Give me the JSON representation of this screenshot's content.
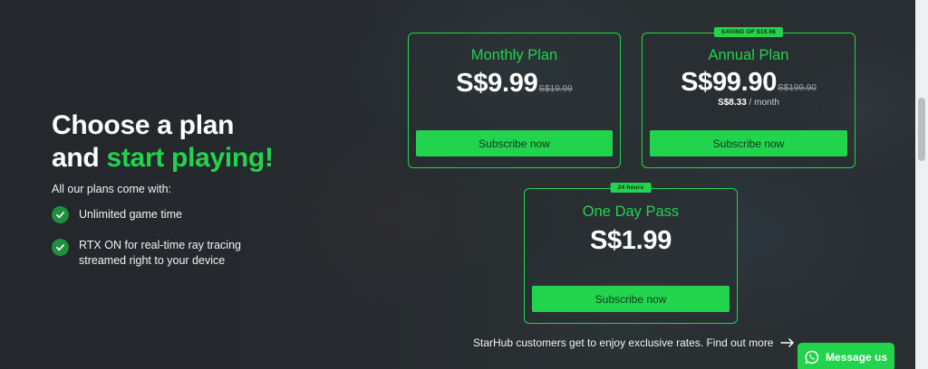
{
  "hero": {
    "heading_line1": "Choose a plan",
    "heading_line2_prefix": "and ",
    "heading_line2_accent": "start playing!",
    "features_intro": "All our plans come with:",
    "features": [
      "Unlimited game time",
      "RTX ON for real-time ray tracing streamed right to your device"
    ]
  },
  "plans": {
    "monthly": {
      "title": "Monthly Plan",
      "price": "S$9.99",
      "old_price": "S$19.99",
      "button": "Subscribe now"
    },
    "annual": {
      "badge": "SAVING OF $19.98",
      "title": "Annual Plan",
      "price": "S$99.90",
      "old_price": "S$199.90",
      "per_month_value": "S$8.33",
      "per_month_unit": " / month",
      "button": "Subscribe now"
    },
    "oneday": {
      "badge": "24 hours",
      "title": "One Day Pass",
      "price": "S$1.99",
      "button": "Subscribe now"
    }
  },
  "starhub_link": "StarHub customers get to enjoy exclusive rates. Find out more",
  "message_button": "Message us",
  "icons": {
    "check": "check-icon",
    "arrow": "arrow-right-icon",
    "whatsapp": "whatsapp-icon"
  },
  "colors": {
    "accent": "#22d34d",
    "background": "#2a2e33"
  }
}
